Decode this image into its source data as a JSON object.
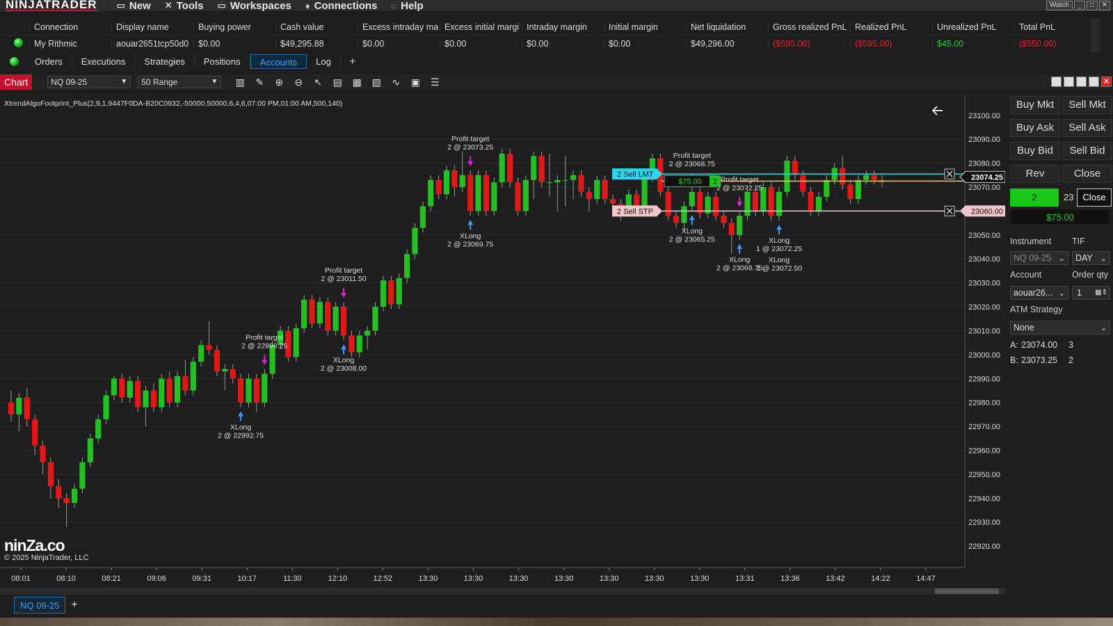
{
  "menubar": {
    "logo": "NINJATRADER",
    "items": [
      {
        "label": "New",
        "icon": "new-window-icon"
      },
      {
        "label": "Tools",
        "icon": "tools-icon"
      },
      {
        "label": "Workspaces",
        "icon": "workspaces-icon"
      },
      {
        "label": "Connections",
        "icon": "connections-icon"
      },
      {
        "label": "Help",
        "icon": "help-icon"
      }
    ],
    "watch_label": "Watch"
  },
  "accounts": {
    "headers": [
      "Connection",
      "Display name",
      "Buying power",
      "Cash value",
      "Excess intraday ma",
      "Excess initial margi",
      "Intraday margin",
      "Initial margin",
      "Net liquidation",
      "Gross realized PnL",
      "Realized PnL",
      "Unrealized PnL",
      "Total PnL"
    ],
    "row": [
      "My Rithmic",
      "aouar2651tcp50d0",
      "$0.00",
      "$49,295.88",
      "$0.00",
      "$0.00",
      "$0.00",
      "$0.00",
      "$49,296.00",
      "($595.00)",
      "($595.00)",
      "$45.00",
      "($550.00)"
    ]
  },
  "tabs": [
    "Orders",
    "Executions",
    "Strategies",
    "Positions",
    "Accounts",
    "Log"
  ],
  "active_tab": "Accounts",
  "chart_header": {
    "label": "Chart",
    "instrument": "NQ 09-25",
    "period": "50 Range"
  },
  "indicator_title": "XtrendAlgoFootprint_Plus(2,9,1,9447F0DA-B20C0932,-50000,50000,6,4,6,07:00 PM,01:00 AM,500,140)",
  "watermark": "ninZa.co",
  "copyright": "© 2025 NinjaTrader, LLC",
  "chart_data": {
    "type": "candlestick",
    "instrument": "NQ 09-25",
    "y_ticks": [
      "23100.00",
      "23090.00",
      "23080.00",
      "23070.00",
      "23060.00",
      "23050.00",
      "23040.00",
      "23030.00",
      "23020.00",
      "23010.00",
      "23000.00",
      "22990.00",
      "22980.00",
      "22970.00",
      "22960.00",
      "22950.00",
      "22940.00",
      "22930.00",
      "22920.00"
    ],
    "ylim": [
      22918,
      23104
    ],
    "x_ticks": [
      "08:01",
      "08:10",
      "08:21",
      "09:06",
      "09:31",
      "10:17",
      "11:30",
      "12:10",
      "12:52",
      "13:30",
      "13:30",
      "13:30",
      "13:30",
      "13:30",
      "13:30",
      "13:30",
      "13:31",
      "13:36",
      "13:42",
      "14:22",
      "14:47"
    ],
    "candles": [
      [
        22980,
        22975,
        22985,
        22972
      ],
      [
        22975,
        22982,
        22984,
        22968
      ],
      [
        22982,
        22973,
        22986,
        22970
      ],
      [
        22973,
        22962,
        22975,
        22958
      ],
      [
        22962,
        22955,
        22964,
        22950
      ],
      [
        22955,
        22945,
        22957,
        22940
      ],
      [
        22945,
        22940,
        22948,
        22936
      ],
      [
        22940,
        22938,
        22942,
        22928
      ],
      [
        22938,
        22944,
        22946,
        22936
      ],
      [
        22944,
        22955,
        22957,
        22942
      ],
      [
        22955,
        22965,
        22967,
        22953
      ],
      [
        22965,
        22973,
        22975,
        22963
      ],
      [
        22973,
        22983,
        22985,
        22971
      ],
      [
        22983,
        22990,
        22991,
        22981
      ],
      [
        22990,
        22982,
        22992,
        22980
      ],
      [
        22982,
        22989,
        22991,
        22980
      ],
      [
        22989,
        22978,
        22991,
        22976
      ],
      [
        22978,
        22985,
        22987,
        22970
      ],
      [
        22985,
        22978,
        22988,
        22976
      ],
      [
        22978,
        22990,
        22992,
        22976
      ],
      [
        22990,
        22980,
        22993,
        22978
      ],
      [
        22980,
        22991,
        22993,
        22978
      ],
      [
        22991,
        22985,
        22998,
        22983
      ],
      [
        22985,
        22997,
        22999,
        22983
      ],
      [
        22997,
        23004,
        23006,
        22995
      ],
      [
        23004,
        23002,
        23014,
        23000
      ],
      [
        23002,
        22993,
        23004,
        22991
      ],
      [
        22993,
        22994,
        22996,
        22985
      ],
      [
        22994,
        22990,
        22996,
        22988
      ],
      [
        22990,
        22980,
        22992,
        22978
      ],
      [
        22980,
        22990,
        22992,
        22978
      ],
      [
        22990,
        22980,
        22992,
        22976
      ],
      [
        22980,
        22992,
        22994,
        22978
      ],
      [
        22992,
        23004,
        23006,
        22990
      ],
      [
        23004,
        23010,
        23012,
        23002
      ],
      [
        23010,
        22999,
        23012,
        22997
      ],
      [
        22999,
        23011,
        23013,
        22997
      ],
      [
        23011,
        23023,
        23025,
        23009
      ],
      [
        23023,
        23013,
        23025,
        23011
      ],
      [
        23013,
        23022,
        23024,
        23011
      ],
      [
        23022,
        23010,
        23024,
        23008
      ],
      [
        23010,
        23020,
        23022,
        23008
      ],
      [
        23020,
        23008,
        23022,
        23006
      ],
      [
        23008,
        23001,
        23010,
        22999
      ],
      [
        23001,
        23008,
        23010,
        22999
      ],
      [
        23008,
        23010,
        23012,
        23002
      ],
      [
        23010,
        23020,
        23022,
        23008
      ],
      [
        23020,
        23031,
        23033,
        23018
      ],
      [
        23031,
        23021,
        23033,
        23019
      ],
      [
        23021,
        23032,
        23034,
        23019
      ],
      [
        23032,
        23042,
        23044,
        23030
      ],
      [
        23042,
        23053,
        23055,
        23040
      ],
      [
        23053,
        23062,
        23064,
        23051
      ],
      [
        23062,
        23073,
        23075,
        23060
      ],
      [
        23073,
        23067,
        23075,
        23065
      ],
      [
        23067,
        23077,
        23079,
        23065
      ],
      [
        23077,
        23070,
        23079,
        23066
      ],
      [
        23070,
        23075,
        23085,
        23068
      ],
      [
        23075,
        23060,
        23077,
        23058
      ],
      [
        23060,
        23075,
        23077,
        23058
      ],
      [
        23075,
        23060,
        23077,
        23058
      ],
      [
        23060,
        23072,
        23074,
        23058
      ],
      [
        23072,
        23084,
        23086,
        23070
      ],
      [
        23084,
        23072,
        23086,
        23070
      ],
      [
        23072,
        23060,
        23074,
        23058
      ],
      [
        23060,
        23073,
        23075,
        23058
      ],
      [
        23073,
        23083,
        23085,
        23065
      ],
      [
        23083,
        23072,
        23085,
        23070
      ],
      [
        23072,
        23072,
        23084,
        23066
      ],
      [
        23072,
        23073,
        23075,
        23060
      ],
      [
        23073,
        23073,
        23083,
        23062
      ],
      [
        23073,
        23075,
        23077,
        23065
      ],
      [
        23075,
        23068,
        23077,
        23066
      ],
      [
        23068,
        23065,
        23070,
        23060
      ],
      [
        23065,
        23073,
        23075,
        23063
      ],
      [
        23073,
        23065,
        23075,
        23063
      ],
      [
        23065,
        23063,
        23067,
        23058
      ],
      [
        23063,
        23060,
        23065,
        23056
      ],
      [
        23060,
        23067,
        23069,
        23058
      ],
      [
        23067,
        23060,
        23069,
        23058
      ],
      [
        23060,
        23074,
        23076,
        23058
      ],
      [
        23074,
        23082,
        23084,
        23072
      ],
      [
        23082,
        23068,
        23084,
        23066
      ],
      [
        23068,
        23058,
        23070,
        23056
      ],
      [
        23058,
        23055,
        23060,
        23053
      ],
      [
        23055,
        23062,
        23064,
        23052
      ],
      [
        23062,
        23068,
        23070,
        23060
      ],
      [
        23068,
        23059,
        23070,
        23057
      ],
      [
        23059,
        23066,
        23068,
        23057
      ],
      [
        23066,
        23058,
        23068,
        23056
      ],
      [
        23058,
        23055,
        23060,
        23053
      ],
      [
        23055,
        23050,
        23057,
        23042
      ],
      [
        23050,
        23058,
        23060,
        23048
      ],
      [
        23058,
        23068,
        23070,
        23056
      ],
      [
        23068,
        23060,
        23070,
        23058
      ],
      [
        23060,
        23070,
        23072,
        23058
      ],
      [
        23070,
        23058,
        23072,
        23056
      ],
      [
        23058,
        23068,
        23070,
        23056
      ],
      [
        23068,
        23081,
        23083,
        23066
      ],
      [
        23081,
        23075,
        23083,
        23073
      ],
      [
        23075,
        23068,
        23077,
        23066
      ],
      [
        23068,
        23060,
        23070,
        23058
      ],
      [
        23060,
        23066,
        23068,
        23058
      ],
      [
        23066,
        23073,
        23075,
        23064
      ],
      [
        23073,
        23078,
        23080,
        23071
      ],
      [
        23078,
        23071,
        23083,
        23069
      ],
      [
        23071,
        23065,
        23073,
        23063
      ],
      [
        23065,
        23073,
        23075,
        23063
      ],
      [
        23073,
        23075,
        23077,
        23071
      ],
      [
        23075,
        23073,
        23077,
        23071
      ],
      [
        23073,
        23072,
        23075,
        23070
      ]
    ],
    "orders": [
      {
        "label": "2  Sell LMT",
        "price": 23075.5,
        "color": "#28d7f0"
      },
      {
        "label": "$75.00",
        "qty": "2",
        "price": 23072.5,
        "color": "#e8c37a"
      },
      {
        "label": "2  Sell STP",
        "price": 23060.0,
        "color": "#f4c6cc"
      }
    ],
    "price_tags": [
      {
        "value": "23074.25",
        "price": 23074.25
      },
      {
        "value": "23060.00",
        "price": 23060.0
      }
    ],
    "annotations": [
      {
        "lines": [
          "XLong",
          "2 @ 22992.75"
        ],
        "dir": "buy",
        "bar": 29
      },
      {
        "lines": [
          "Profit target",
          "2 @ 22996.25"
        ],
        "dir": "sell",
        "bar": 32
      },
      {
        "lines": [
          "XLong",
          "2 @ 23008.00"
        ],
        "dir": "buy",
        "bar": 42
      },
      {
        "lines": [
          "Profit target",
          "2 @ 23011.50"
        ],
        "dir": "sell",
        "bar": 42
      },
      {
        "lines": [
          "XLong",
          "2 @ 23069.75"
        ],
        "dir": "buy",
        "bar": 58
      },
      {
        "lines": [
          "Profit target",
          "2 @ 23073.25"
        ],
        "dir": "sell",
        "bar": 58
      },
      {
        "lines": [
          "XLong",
          "2 @ 23065.25"
        ],
        "dir": "buy",
        "bar": 86
      },
      {
        "lines": [
          "Profit target",
          "2 @ 23068.75"
        ],
        "dir": "sell",
        "bar": 86
      },
      {
        "lines": [
          "XLong",
          "2 @ 23068.75"
        ],
        "dir": "buy",
        "bar": 92
      },
      {
        "lines": [
          "Profit target",
          "2 @ 23072.25"
        ],
        "dir": "sell",
        "bar": 92
      },
      {
        "lines": [
          "XLong",
          "1 @ 23072.25"
        ],
        "dir": "buy",
        "bar": 97
      },
      {
        "lines": [
          "XLong",
          "1 @ 23072.50"
        ],
        "dir": "buy",
        "bar": 97
      }
    ]
  },
  "order_panel": {
    "buttons": [
      [
        "Buy Mkt",
        "Sell Mkt"
      ],
      [
        "Buy Ask",
        "Sell Ask"
      ],
      [
        "Buy Bid",
        "Sell Bid"
      ],
      [
        "Rev",
        "Close"
      ]
    ],
    "position_qty": "2",
    "position_price": "23",
    "tooltip": "Close",
    "pnl": "$75.00",
    "instrument_label": "Instrument",
    "instrument_value": "NQ 09-25",
    "tif_label": "TIF",
    "tif_value": "DAY",
    "account_label": "Account",
    "account_value": "aouar26...",
    "qty_label": "Order qty",
    "qty_value": "1",
    "atm_label": "ATM Strategy",
    "atm_value": "None",
    "ask": {
      "label": "A:",
      "price": "23074.00",
      "size": "3"
    },
    "bid": {
      "label": "B:",
      "price": "23073.25",
      "size": "2"
    }
  },
  "bottom_tab": "NQ 09-25",
  "colors": {
    "up": "#22c022",
    "down": "#e01818",
    "accent": "#c8102e"
  }
}
